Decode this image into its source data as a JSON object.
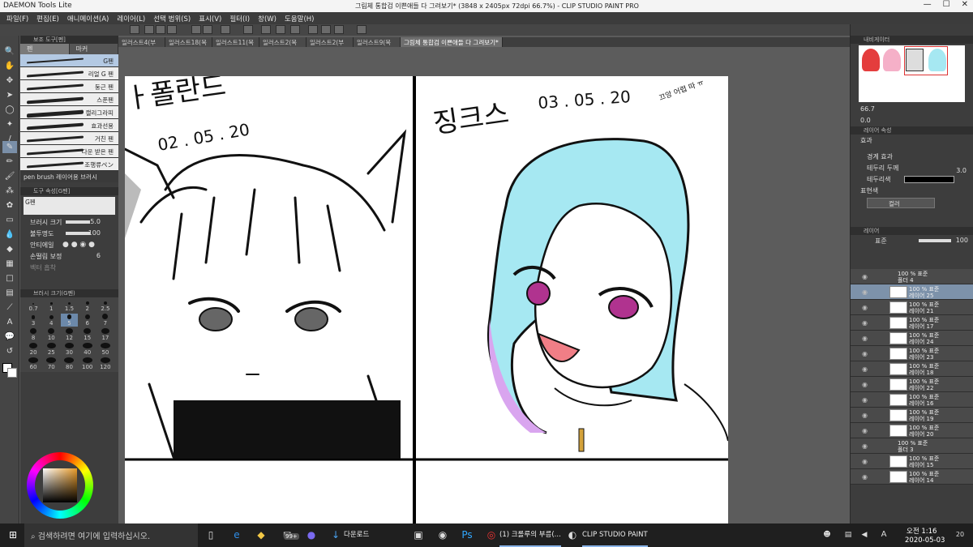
{
  "titlebar": {
    "left_app": "DAEMON Tools Lite",
    "title": "그림체 통합검 이쁜애들 다 그려보기* (3848 x 2405px 72dpi 66.7%)  - CLIP STUDIO PAINT PRO",
    "minimize": "—",
    "maximize": "☐",
    "close": "✕"
  },
  "menu": [
    "파일(F)",
    "편집(E)",
    "애니메이션(A)",
    "레이어(L)",
    "선택 범위(S)",
    "표시(V)",
    "필터(I)",
    "창(W)",
    "도움말(H)"
  ],
  "tabs": [
    "일러스트4(부",
    "일러스트18(복",
    "일러스트11(복",
    "일러스트2(복",
    "일러스트2(부",
    "일러스트9(복",
    "그림체 통합검 이쁜애들 다 그려보기*"
  ],
  "left_panel": {
    "subtool_title": "보조 도구[펜]",
    "subtabs": [
      "펜",
      "마커"
    ],
    "brushes": [
      "G펜",
      "리얼 G 펜",
      "둥근 펜",
      "스푼펜",
      "캘리그라피",
      "효과선용",
      "거친 펜",
      "다운 받은 펜",
      "조행류ペン"
    ],
    "custom_brush": "pen brush 레이어용 브러시",
    "prop_title": "도구 속성[G펜]",
    "prop_brush": "G펜",
    "props": [
      {
        "label": "브러시 크기",
        "value": "5.0"
      },
      {
        "label": "불투명도",
        "value": "100"
      },
      {
        "label": "안티에일",
        "value": ""
      },
      {
        "label": "손떨림 보정",
        "value": "6"
      }
    ],
    "vector": "벡터 흡착",
    "size_title": "브러시 크기(G펜)",
    "sizes": [
      "0.7",
      "1",
      "1.5",
      "2",
      "2.5",
      "3",
      "4",
      "5",
      "6",
      "7",
      "8",
      "10",
      "12",
      "15",
      "17",
      "20",
      "25",
      "30",
      "40",
      "50",
      "60",
      "70",
      "80",
      "100",
      "120"
    ]
  },
  "right_panel": {
    "navigator": "내비게이터",
    "zoom": "66.7",
    "rotate": "0.0",
    "layer_prop": "레이어 속성",
    "effect": "효과",
    "border_effect": "경계 효과",
    "border_width": "테두리 두께",
    "border_width_value": "3.0",
    "border_color": "테두리색",
    "expression": "표현색",
    "expression_value": "컬러",
    "layers_title": "레이어",
    "blend": "표준",
    "opacity": "100",
    "layers": [
      {
        "kind": "folder",
        "t1": "100 % 표준",
        "t2": "폴더 4"
      },
      {
        "kind": "layer",
        "t1": "100 % 표준",
        "t2": "레이어 25",
        "sel": true
      },
      {
        "kind": "layer",
        "t1": "100 % 표준",
        "t2": "레이어 21"
      },
      {
        "kind": "layer",
        "t1": "100 % 표준",
        "t2": "레이어 17"
      },
      {
        "kind": "layer",
        "t1": "100 % 표준",
        "t2": "레이어 24"
      },
      {
        "kind": "layer",
        "t1": "100 % 표준",
        "t2": "레이어 23"
      },
      {
        "kind": "layer",
        "t1": "100 % 표준",
        "t2": "레이어 18"
      },
      {
        "kind": "layer",
        "t1": "100 % 표준",
        "t2": "레이어 22"
      },
      {
        "kind": "layer",
        "t1": "100 % 표준",
        "t2": "레이어 16"
      },
      {
        "kind": "layer",
        "t1": "100 % 표준",
        "t2": "레이어 19"
      },
      {
        "kind": "layer",
        "t1": "100 % 표준",
        "t2": "레이어 20"
      },
      {
        "kind": "folder",
        "t1": "100 % 표준",
        "t2": "폴더 3"
      },
      {
        "kind": "layer",
        "t1": "100 % 표준",
        "t2": "레이어 15"
      },
      {
        "kind": "layer",
        "t1": "100 % 표준",
        "t2": "레이어 14"
      }
    ]
  },
  "canvas": {
    "left_name": "ㅏ폴란드",
    "left_date": "02 . 05 . 20",
    "right_name": "징크스",
    "right_date": "03 . 05 . 20",
    "right_note": "끄앙 어렵 따 ㅠ",
    "hair_color": "#9fe6f0",
    "hair_tip": "#d49cf0",
    "eye_color": "#b0338f",
    "tongue": "#f07e86"
  },
  "taskbar": {
    "search_placeholder": "검색하려면 여기에 입력하십시오.",
    "badge": "99+",
    "downloads": "다운로드",
    "chrome_app": "(1) 크롤루의 부름(...",
    "csp_app": "CLIP STUDIO PAINT",
    "time": "오전 1:16",
    "date": "2020-05-03",
    "lang": "A",
    "notif": "20"
  }
}
